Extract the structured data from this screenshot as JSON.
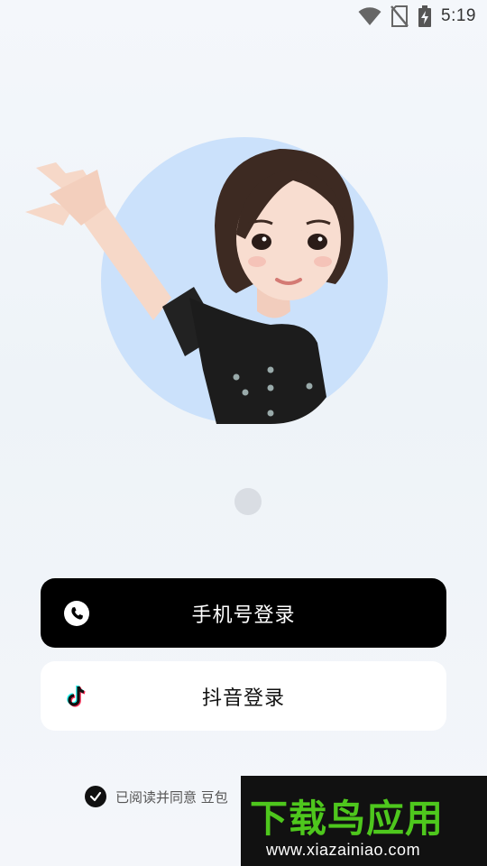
{
  "status_bar": {
    "time": "5:19",
    "icons": [
      "wifi-icon",
      "no-sim-icon",
      "battery-charging-icon"
    ]
  },
  "onboarding": {
    "avatar": "avatar-illustration",
    "page_indicator": {
      "current": 1,
      "total": 1
    }
  },
  "login": {
    "phone_label": "手机号登录",
    "phone_icon": "phone-icon",
    "douyin_label": "抖音登录",
    "douyin_icon": "douyin-icon"
  },
  "agreement": {
    "checked": true,
    "text": "已阅读并同意 豆包"
  },
  "watermark": {
    "title": "下载鸟应用",
    "url": "www.xiazainiao.com"
  },
  "colors": {
    "circle": "#cbe1fb",
    "primary_button": "#000000",
    "secondary_button": "#ffffff",
    "watermark_green": "#4ec71d"
  }
}
